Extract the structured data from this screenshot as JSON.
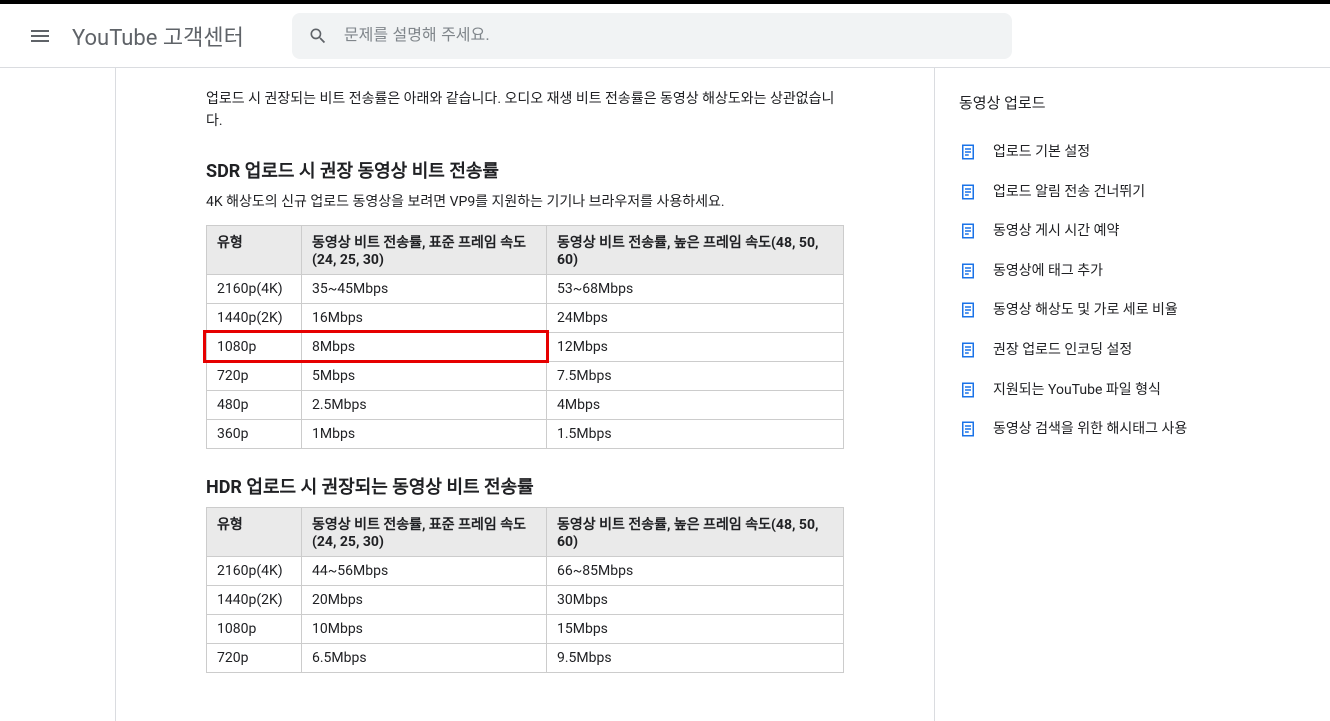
{
  "header": {
    "title": "YouTube 고객센터",
    "search_placeholder": "문제를 설명해 주세요."
  },
  "article": {
    "intro": "업로드 시 권장되는 비트 전송률은 아래와 같습니다. 오디오 재생 비트 전송률은 동영상 해상도와는 상관없습니다.",
    "sdr_heading": "SDR 업로드 시 권장 동영상 비트 전송률",
    "sdr_sub": "4K 해상도의 신규 업로드 동영상을 보려면 VP9를 지원하는 기기나 브라우저를 사용하세요.",
    "hdr_heading": "HDR 업로드 시 권장되는 동영상 비트 전송률",
    "table_headers": {
      "type": "유형",
      "std": "동영상 비트 전송률, 표준 프레임 속도(24, 25, 30)",
      "high": "동영상 비트 전송률, 높은 프레임 속도(48, 50, 60)"
    },
    "sdr_rows": [
      {
        "type": "2160p(4K)",
        "std": "35~45Mbps",
        "high": "53~68Mbps"
      },
      {
        "type": "1440p(2K)",
        "std": "16Mbps",
        "high": "24Mbps"
      },
      {
        "type": "1080p",
        "std": "8Mbps",
        "high": "12Mbps"
      },
      {
        "type": "720p",
        "std": "5Mbps",
        "high": "7.5Mbps"
      },
      {
        "type": "480p",
        "std": "2.5Mbps",
        "high": "4Mbps"
      },
      {
        "type": "360p",
        "std": "1Mbps",
        "high": "1.5Mbps"
      }
    ],
    "hdr_rows": [
      {
        "type": "2160p(4K)",
        "std": "44~56Mbps",
        "high": "66~85Mbps"
      },
      {
        "type": "1440p(2K)",
        "std": "20Mbps",
        "high": "30Mbps"
      },
      {
        "type": "1080p",
        "std": "10Mbps",
        "high": "15Mbps"
      },
      {
        "type": "720p",
        "std": "6.5Mbps",
        "high": "9.5Mbps"
      }
    ],
    "highlight_row_index": 2
  },
  "sidebar": {
    "heading": "동영상 업로드",
    "items": [
      "업로드 기본 설정",
      "업로드 알림 전송 건너뛰기",
      "동영상 게시 시간 예약",
      "동영상에 태그 추가",
      "동영상 해상도 및 가로 세로 비율",
      "권장 업로드 인코딩 설정",
      "지원되는 YouTube 파일 형식",
      "동영상 검색을 위한 해시태그 사용"
    ]
  }
}
